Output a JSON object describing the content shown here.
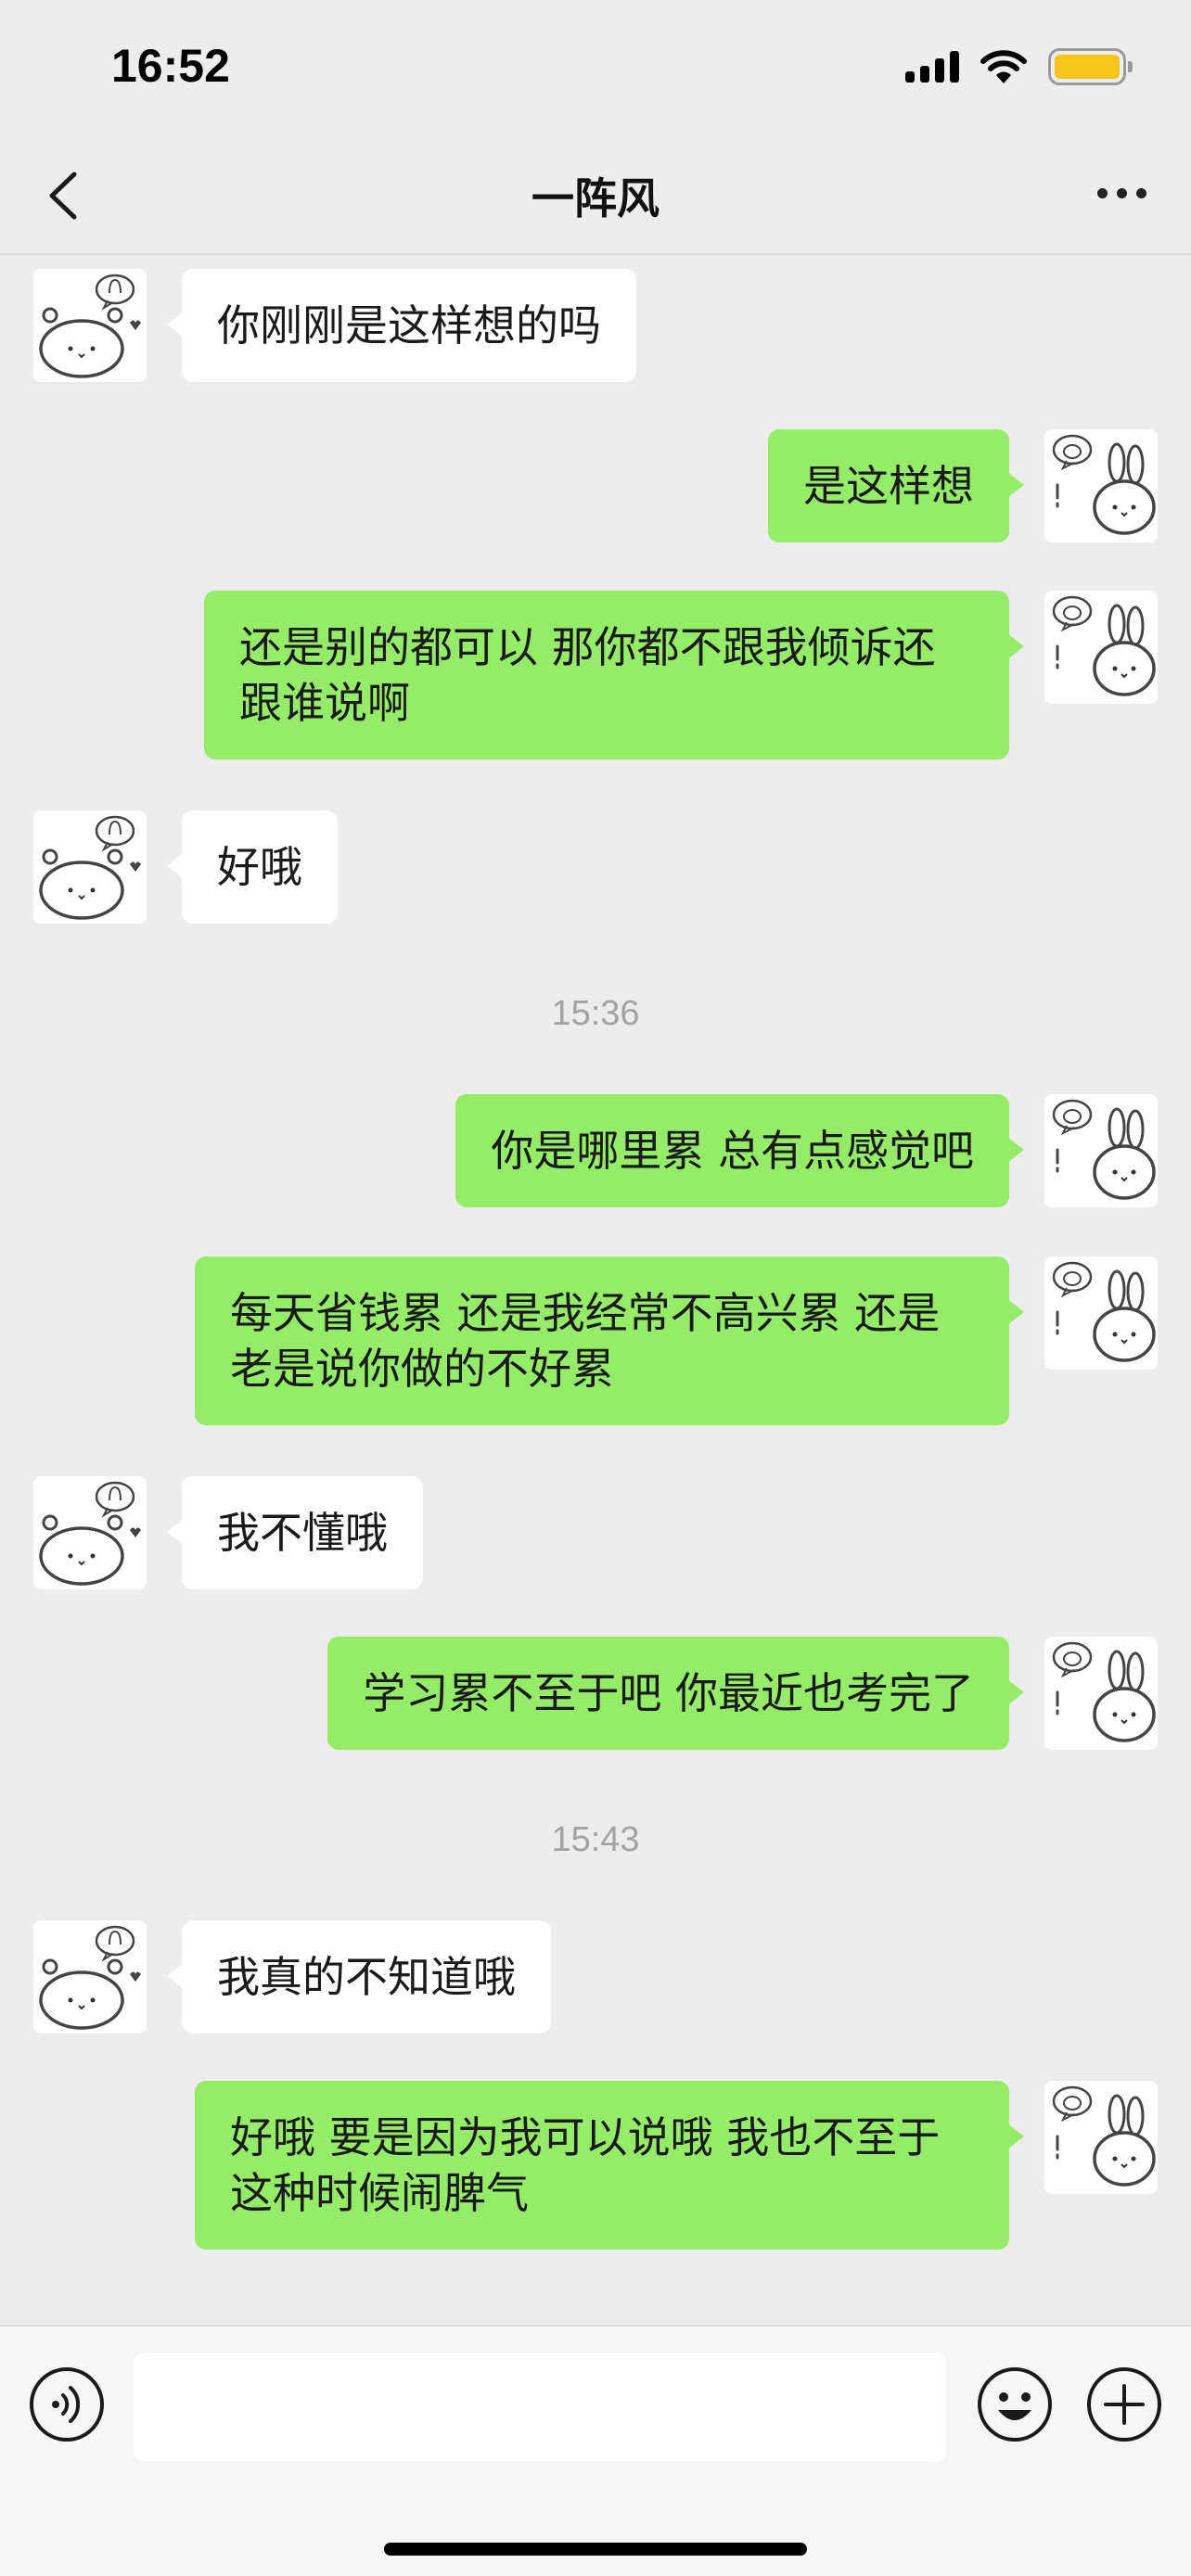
{
  "status_bar": {
    "time": "16:52",
    "signal_icon": "cellular-signal-icon",
    "wifi_icon": "wifi-icon",
    "battery_color": "#f7c61b"
  },
  "header": {
    "title": "一阵风",
    "back_icon": "chevron-left-icon",
    "more_icon": "ellipsis-icon"
  },
  "messages": [
    {
      "side": "left",
      "text": "你刚刚是这样想的吗"
    },
    {
      "side": "right",
      "text": "是这样想"
    },
    {
      "side": "right",
      "text": "还是别的都可以 那你都不跟我倾诉还跟谁说啊"
    },
    {
      "side": "left",
      "text": "好哦"
    },
    {
      "timestamp": "15:36"
    },
    {
      "side": "right",
      "text": "你是哪里累 总有点感觉吧"
    },
    {
      "side": "right",
      "text": "每天省钱累 还是我经常不高兴累 还是老是说你做的不好累"
    },
    {
      "side": "left",
      "text": "我不懂哦"
    },
    {
      "side": "right",
      "text": "学习累不至于吧 你最近也考完了"
    },
    {
      "timestamp": "15:43"
    },
    {
      "side": "left",
      "text": "我真的不知道哦"
    },
    {
      "side": "right",
      "text": "好哦 要是因为我可以说哦 我也不至于这种时候闹脾气"
    }
  ],
  "input_bar": {
    "voice_icon": "voice-icon",
    "text_value": "",
    "emoji_icon": "smiley-icon",
    "plus_icon": "plus-icon"
  },
  "colors": {
    "background": "#ededed",
    "sent_bubble": "#95ec69",
    "received_bubble": "#ffffff",
    "timestamp": "#a3a3a3"
  }
}
